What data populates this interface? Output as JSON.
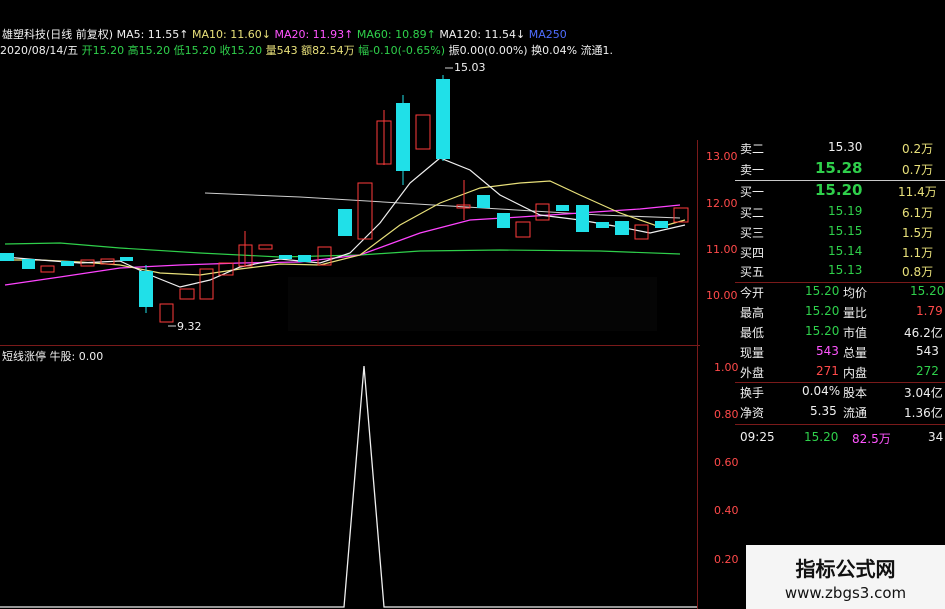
{
  "header": {
    "stock_title": "雄塑科技(日线 前复权)",
    "ma5": "MA5: 11.55↑",
    "ma10": "MA10: 11.60↓",
    "ma20": "MA20: 11.93↑",
    "ma60": "MA60: 10.89↑",
    "ma120": "MA120: 11.54↓",
    "ma250": "MA250",
    "date": "2020/08/14/五",
    "open": "开15.20",
    "high": "高15.20",
    "low": "低15.20",
    "close": "收15.20",
    "volume": "量543",
    "amount": "额82.54万",
    "change": "幅-0.10(-0.65%)",
    "amplitude": "振0.00(0.00%)",
    "turnover": "换0.04%",
    "float": "流通1.",
    "high_marker": "15.03",
    "low_marker": "9.32"
  },
  "price_axis": [
    "13.00",
    "12.00",
    "11.00",
    "10.00"
  ],
  "indicator": {
    "title": "短线涨停  牛股: 0.00",
    "axis": [
      "1.00",
      "0.80",
      "0.60",
      "0.40",
      "0.20"
    ]
  },
  "orderbook": {
    "sell": [
      {
        "label": "卖二",
        "price": "15.30",
        "vol": "0.2万"
      },
      {
        "label": "卖一",
        "price": "15.28",
        "vol": "0.7万"
      }
    ],
    "buy": [
      {
        "label": "买一",
        "price": "15.20",
        "vol": "11.4万"
      },
      {
        "label": "买二",
        "price": "15.19",
        "vol": "6.1万"
      },
      {
        "label": "买三",
        "price": "15.15",
        "vol": "1.5万"
      },
      {
        "label": "买四",
        "price": "15.14",
        "vol": "1.1万"
      },
      {
        "label": "买五",
        "price": "15.13",
        "vol": "0.8万"
      }
    ]
  },
  "stats": [
    {
      "l1": "今开",
      "v1": "15.20",
      "l2": "均价",
      "v2": "15.20"
    },
    {
      "l1": "最高",
      "v1": "15.20",
      "l2": "量比",
      "v2": "1.79"
    },
    {
      "l1": "最低",
      "v1": "15.20",
      "l2": "市值",
      "v2": "46.2亿"
    },
    {
      "l1": "现量",
      "v1": "543",
      "l2": "总量",
      "v2": "543"
    },
    {
      "l1": "外盘",
      "v1": "271",
      "l2": "内盘",
      "v2": "272"
    },
    {
      "l1": "换手",
      "v1": "0.04%",
      "l2": "股本",
      "v2": "3.04亿"
    },
    {
      "l1": "净资",
      "v1": "5.35",
      "l2": "流通",
      "v2": "1.36亿"
    }
  ],
  "tick": {
    "time": "09:25",
    "price": "15.20",
    "amount": "82.5万",
    "count": "34"
  },
  "watermark": {
    "title": "指标公式网",
    "url": "www.zbgs3.com"
  },
  "colors": {
    "up": "#ff3b3b",
    "down": "#20e0e8",
    "ma5": "#f0f0f0",
    "ma10": "#e8e07a",
    "ma20": "#ff55ff",
    "ma60": "#2fd04b",
    "ma120": "#d8d8d8"
  }
}
